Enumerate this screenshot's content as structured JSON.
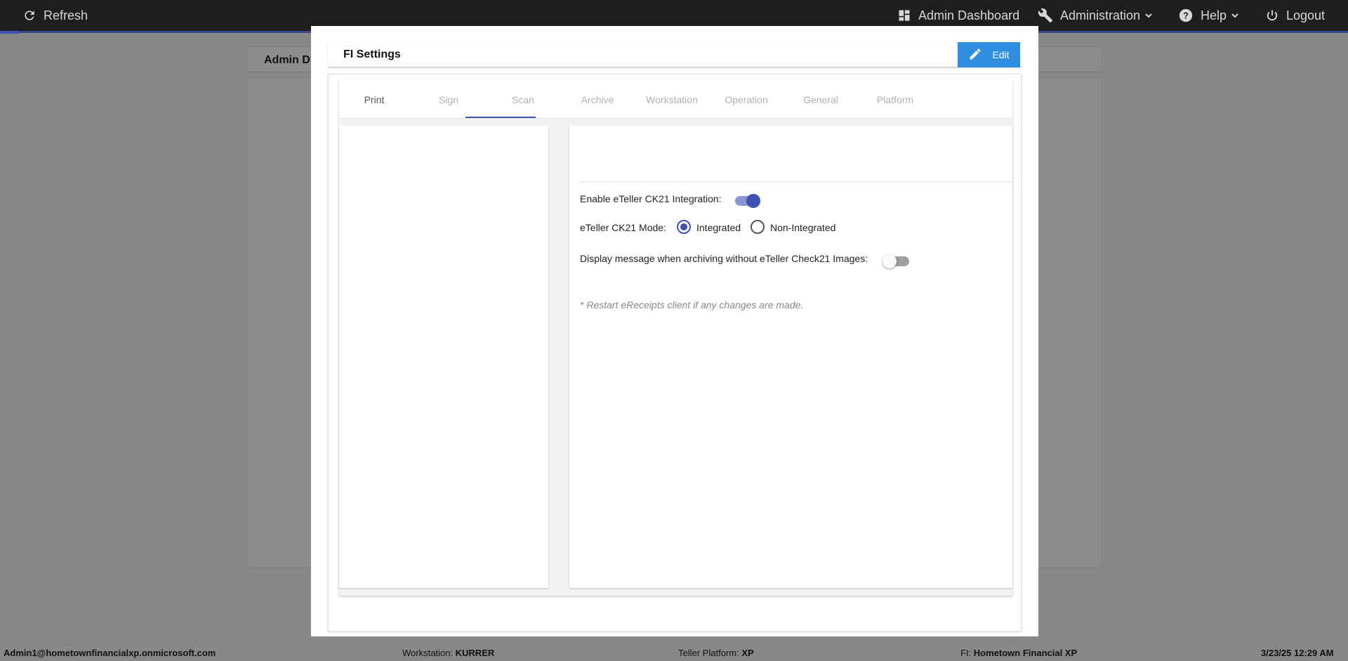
{
  "topbar": {
    "refresh_label": "Refresh",
    "admin_dashboard_label": "Admin Dashboard",
    "administration_label": "Administration",
    "help_label": "Help",
    "logout_label": "Logout"
  },
  "background": {
    "header_title": "Admin D"
  },
  "modal": {
    "title": "FI Settings",
    "edit_label": "Edit",
    "tabs": [
      {
        "label": "Print"
      },
      {
        "label": "Sign"
      },
      {
        "label": "Scan"
      },
      {
        "label": "Archive"
      },
      {
        "label": "Workstation"
      },
      {
        "label": "Operation"
      },
      {
        "label": "General"
      },
      {
        "label": "Platform"
      }
    ],
    "active_tab": "Scan",
    "settings": {
      "enable_ck21_label": "Enable eTeller CK21 Integration:",
      "enable_ck21_on": true,
      "mode_label": "eTeller CK21 Mode:",
      "mode_options": [
        {
          "label": "Integrated",
          "checked": true
        },
        {
          "label": "Non-Integrated",
          "checked": false
        }
      ],
      "display_msg_label": "Display message when archiving without eTeller Check21 Images:",
      "display_msg_on": false,
      "restart_note": "* Restart eReceipts client if any changes are made."
    }
  },
  "statusbar": {
    "user": "Admin1@hometownfinancialxp.onmicrosoft.com",
    "workstation_label": "Workstation:",
    "workstation_value": "KURRER",
    "platform_label": "Teller Platform:",
    "platform_value": "XP",
    "fi_label": "FI:",
    "fi_value": "Hometown Financial XP",
    "datetime": "3/23/25 12:29 AM"
  },
  "colors": {
    "accent": "#3f51b5",
    "edit_button": "#2f8ee0",
    "topbar": "#1e1e1e",
    "overlay": "#888888"
  }
}
